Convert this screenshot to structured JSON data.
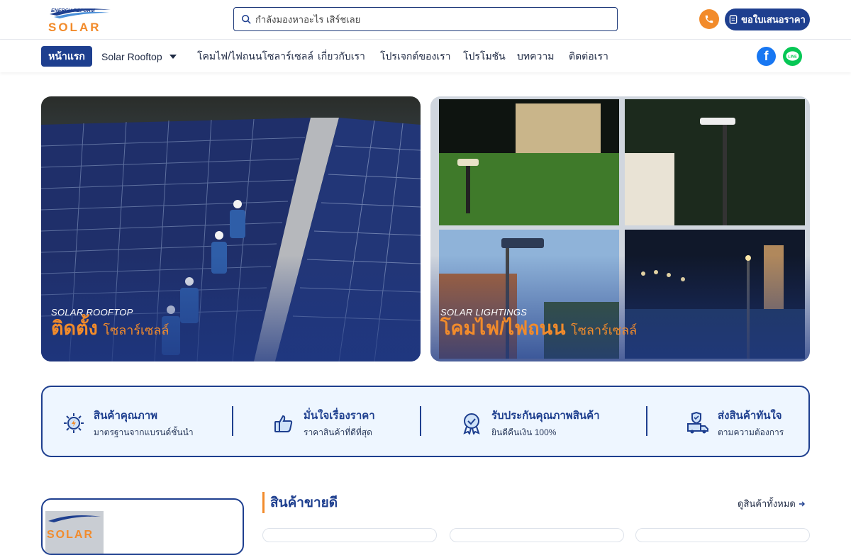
{
  "header": {
    "logo_top": "ENERGY REFORM",
    "logo_main": "SOLAR",
    "search_placeholder": "กำลังมองหาอะไร เสิร์ชเลย",
    "quote_label": "ขอใบเสนอราคา",
    "icons": {
      "search": "search-icon",
      "phone": "phone-icon",
      "quote": "document-icon"
    }
  },
  "nav": {
    "items": [
      {
        "label": "หน้าแรก"
      },
      {
        "label": "Solar Rooftop"
      },
      {
        "label": "โคมไฟ/ไฟถนนโซลาร์เซลล์"
      },
      {
        "label": "เกี่ยวกับเรา"
      },
      {
        "label": "โปรเจกต์ของเรา"
      },
      {
        "label": "โปรโมชัน"
      },
      {
        "label": "บทความ"
      },
      {
        "label": "ติดต่อเรา"
      }
    ],
    "social": {
      "facebook": "facebook-icon",
      "line": "line-icon",
      "line_text": "LINE"
    }
  },
  "banners": [
    {
      "sub": "SOLAR ROOFTOP",
      "title_main": "ติดตั้ง",
      "title_small": "โซลาร์เซลล์"
    },
    {
      "sub": "SOLAR LIGHTINGS",
      "title_main": "โคมไฟ/ไฟถนน",
      "title_small": "โซลาร์เซลล์"
    }
  ],
  "features": [
    {
      "title": "สินค้าคุณภาพ",
      "desc": "มาตรฐานจากแบรนด์ชั้นนำ",
      "icon": "solar-energy-icon"
    },
    {
      "title": "มั่นใจเรื่องราคา",
      "desc": "ราคาสินค้าที่ดีที่สุด",
      "icon": "thumbs-up-icon"
    },
    {
      "title": "รับประกันคุณภาพสินค้า",
      "desc": "ยินดีคืนเงิน 100%",
      "icon": "award-badge-icon"
    },
    {
      "title": "ส่งสินค้าทันใจ",
      "desc": "ตามความต้องการ",
      "icon": "delivery-truck-icon"
    }
  ],
  "products": {
    "section_title": "สินค้าขายดี",
    "view_all": "ดูสินค้าทั้งหมด"
  },
  "colors": {
    "primary": "#1e3f8f",
    "accent": "#f28b2b"
  }
}
